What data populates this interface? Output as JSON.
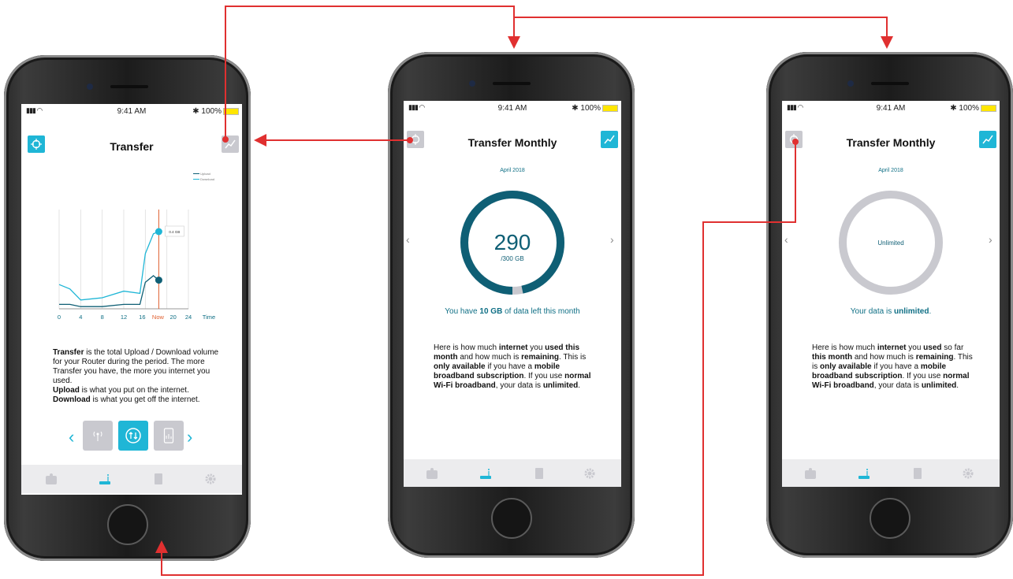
{
  "colors": {
    "teal": "#1fb6d6",
    "dark_teal": "#0f5f75",
    "connector": "#e03030",
    "ring_empty": "#c9c9cf",
    "now_line": "#e06030"
  },
  "status_bar": {
    "time": "9:41 AM",
    "battery": "100%"
  },
  "screen1": {
    "title": "Transfer",
    "legend": [
      "Upload",
      "Download"
    ],
    "tooltip": "0.4 GB",
    "x_ticks": [
      "0",
      "4",
      "8",
      "12",
      "16",
      "Now",
      "20",
      "24"
    ],
    "x_label": "Time",
    "paragraph": [
      {
        "b": "Transfer"
      },
      {
        "t": " is the total Upload / Download volume for your Router during the period. The more Transfer you have, the more you internet you used."
      },
      {
        "br": true
      },
      {
        "b": "Upload"
      },
      {
        "t": " is what you put on the internet."
      },
      {
        "br": true
      },
      {
        "b": "Download"
      },
      {
        "t": " is what you get off the internet."
      }
    ],
    "icons": [
      "radio-icon",
      "transfer-icon",
      "phone-icon"
    ]
  },
  "screen2": {
    "title": "Transfer Monthly",
    "month": "April 2018",
    "value": "290",
    "unit": "/300 GB",
    "used_fraction": 0.9667,
    "left_msg_pre": "You have ",
    "left_msg_bold": "10 GB",
    "left_msg_post": " of data left this month"
  },
  "screen3": {
    "title": "Transfer Monthly",
    "month": "April 2018",
    "ring_label": "Unlimited",
    "msg_pre": "Your data is ",
    "msg_bold": "unlimited",
    "msg_post": "."
  },
  "chart_data": {
    "type": "line",
    "x": [
      0,
      2,
      4,
      8,
      12,
      15,
      16,
      17.5,
      18.5
    ],
    "xlim": [
      0,
      24
    ],
    "xlabel": "Time",
    "series": [
      {
        "name": "Upload",
        "values": [
          0.02,
          0.02,
          0.01,
          0.01,
          0.02,
          0.02,
          0.12,
          0.15,
          0.13
        ]
      },
      {
        "name": "Download",
        "values": [
          0.11,
          0.09,
          0.04,
          0.05,
          0.08,
          0.07,
          0.25,
          0.34,
          0.35
        ]
      }
    ],
    "highlight": {
      "label": "Now",
      "x": 18.5
    },
    "ylim": [
      0,
      0.45
    ]
  }
}
